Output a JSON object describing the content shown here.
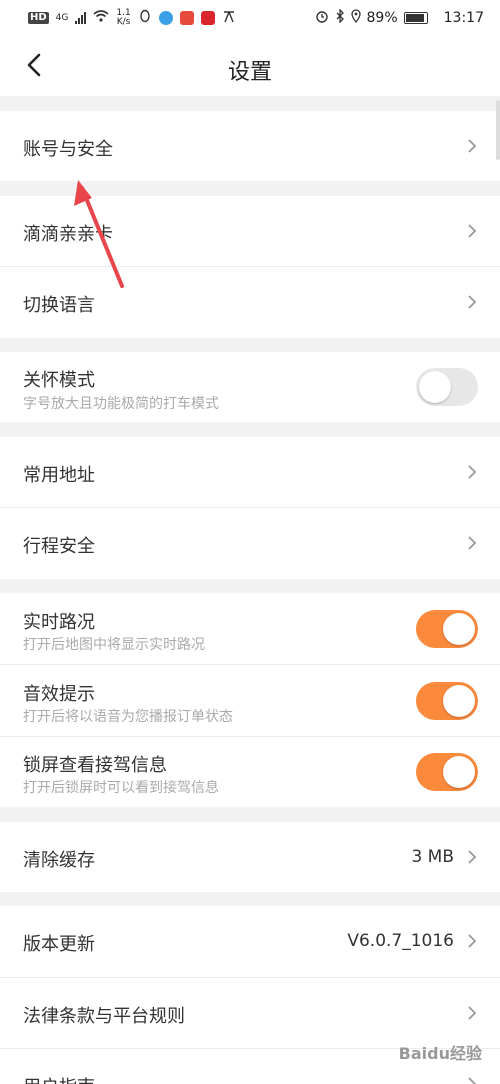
{
  "status_bar": {
    "hd": "HD",
    "net": "4G",
    "speed_value": "1.1",
    "speed_unit": "K/s",
    "battery": "89%",
    "time": "13:17"
  },
  "header": {
    "title": "设置"
  },
  "rows": {
    "account": "账号与安全",
    "family_card": "滴滴亲亲卡",
    "language": "切换语言",
    "care_mode": {
      "label": "关怀模式",
      "sub": "字号放大且功能极简的打车模式",
      "on": false
    },
    "address": "常用地址",
    "trip_safety": "行程安全",
    "traffic": {
      "label": "实时路况",
      "sub": "打开后地图中将显示实时路况",
      "on": true
    },
    "sound": {
      "label": "音效提示",
      "sub": "打开后将以语音为您播报订单状态",
      "on": true
    },
    "lock_screen": {
      "label": "锁屏查看接驾信息",
      "sub": "打开后锁屏时可以看到接驾信息",
      "on": true
    },
    "clear_cache": {
      "label": "清除缓存",
      "value": "3 MB"
    },
    "version": {
      "label": "版本更新",
      "value": "V6.0.7_1016"
    },
    "legal": "法律条款与平台规则",
    "guide": "用户指南"
  },
  "colors": {
    "accent": "#fb8a3d",
    "annotation_arrow": "#e8464b"
  },
  "watermark": "Baidu经验"
}
